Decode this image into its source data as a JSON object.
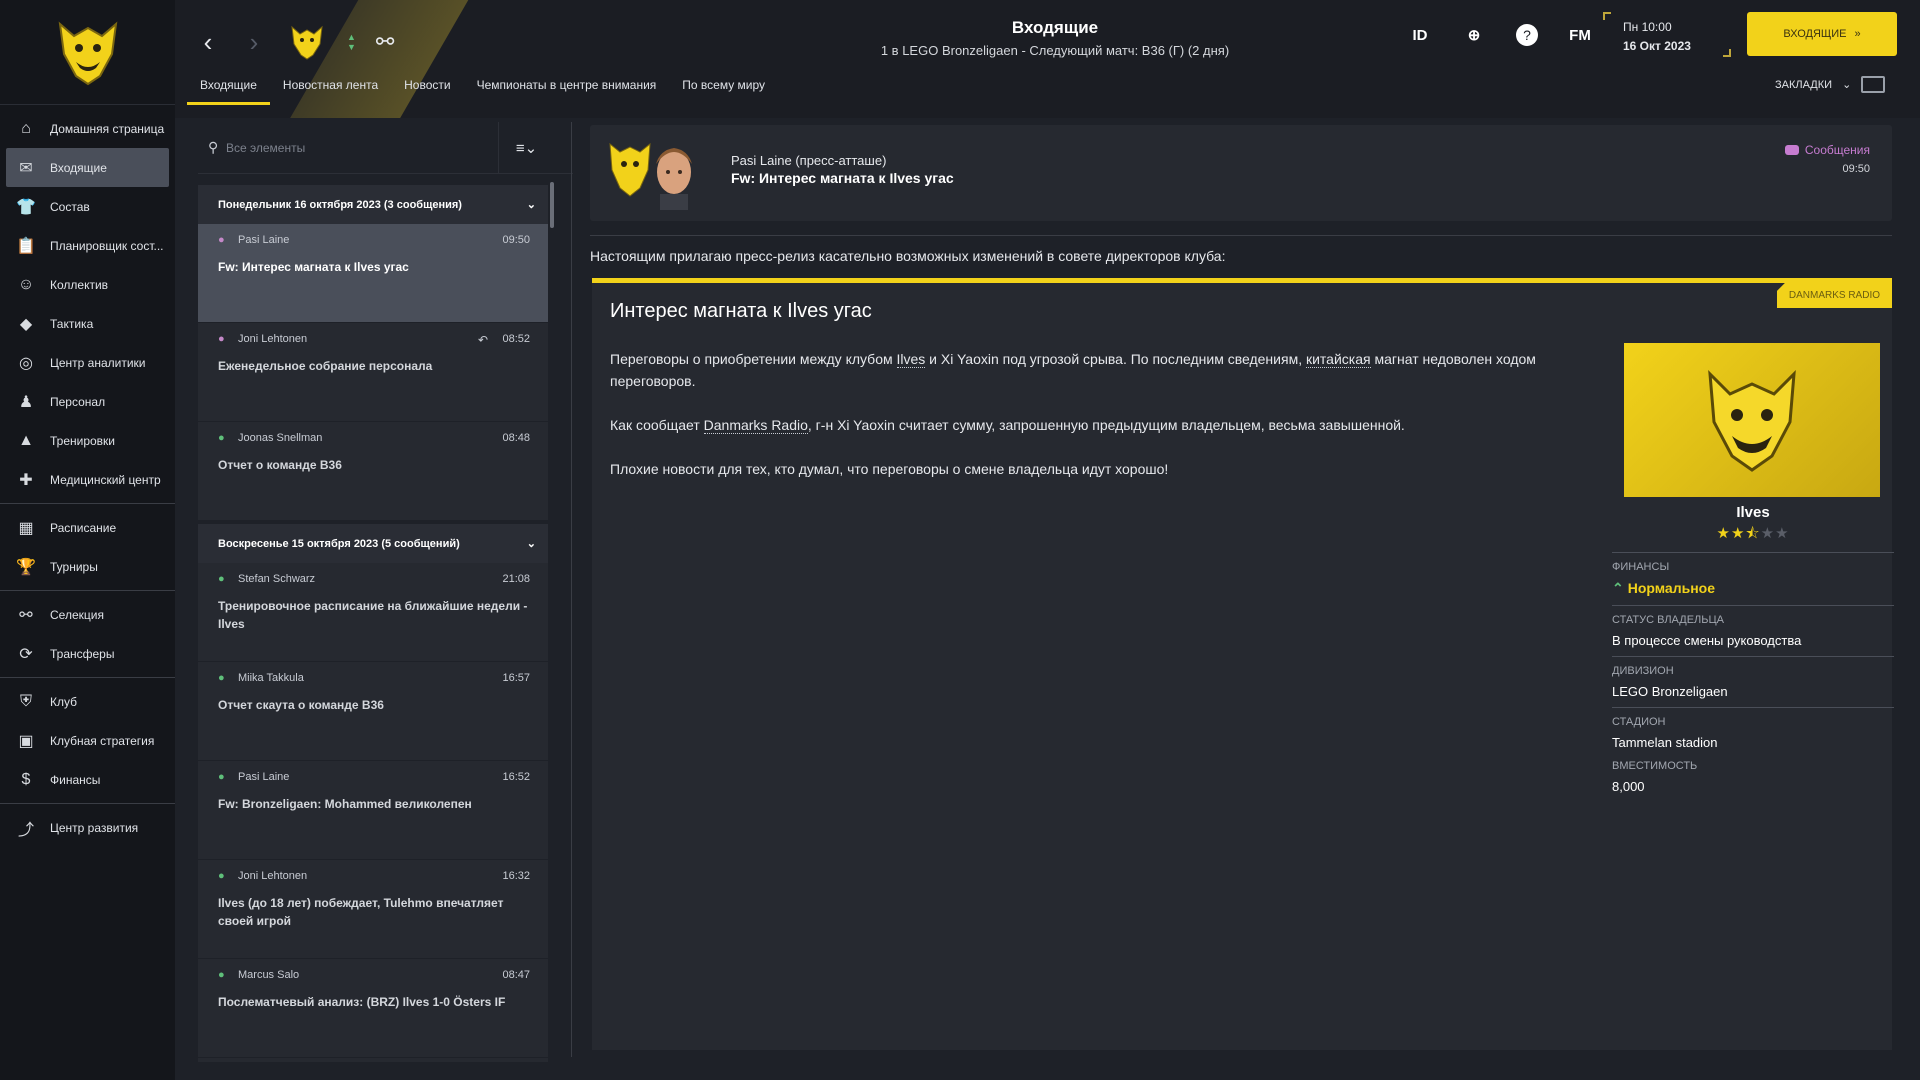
{
  "sidebar": {
    "items": [
      {
        "label": "Домашняя страница",
        "icon": "home-icon"
      },
      {
        "label": "Входящие",
        "icon": "mail-icon"
      },
      {
        "label": "Состав",
        "icon": "shirt-icon"
      },
      {
        "label": "Планировщик сост...",
        "icon": "clipboard-icon"
      },
      {
        "label": "Коллектив",
        "icon": "head-icon"
      },
      {
        "label": "Тактика",
        "icon": "tactics-icon"
      },
      {
        "label": "Центр аналитики",
        "icon": "analytics-icon"
      },
      {
        "label": "Персонал",
        "icon": "staff-icon"
      },
      {
        "label": "Тренировки",
        "icon": "cone-icon"
      },
      {
        "label": "Медицинский центр",
        "icon": "medical-icon"
      },
      {
        "label": "Расписание",
        "icon": "calendar-icon"
      },
      {
        "label": "Турниры",
        "icon": "trophy-icon"
      },
      {
        "label": "Селекция",
        "icon": "binoculars-icon"
      },
      {
        "label": "Трансферы",
        "icon": "transfer-icon"
      },
      {
        "label": "Клуб",
        "icon": "shield-icon"
      },
      {
        "label": "Клубная стратегия",
        "icon": "briefcase-icon"
      },
      {
        "label": "Финансы",
        "icon": "money-icon"
      },
      {
        "label": "Центр развития",
        "icon": "chart-icon"
      }
    ]
  },
  "header": {
    "title": "Входящие",
    "subtitle": "1 в LEGO Bronzeligaen - Следующий матч: B36 (Г) (2 дня)",
    "id_label": "ID",
    "fm_label": "FM",
    "time": "Пн 10:00",
    "date": "16 Окт 2023",
    "continue_label": "ВХОДЯЩИЕ",
    "bookmarks_label": "ЗАКЛАДКИ",
    "tabs": [
      "Входящие",
      "Новостная лента",
      "Новости",
      "Чемпионаты в центре внимания",
      "По всему миру"
    ]
  },
  "inbox": {
    "search_placeholder": "Все элементы",
    "groups": [
      {
        "title": "Понедельник 16 октября 2023 (3 сообщения)",
        "messages": [
          {
            "from": "Pasi Laine",
            "time": "09:50",
            "subject": "Fw: Интерес магната к Ilves угас"
          },
          {
            "from": "Joni Lehtonen",
            "time": "08:52",
            "subject": "Еженедельное собрание персонала"
          },
          {
            "from": "Joonas Snellman",
            "time": "08:48",
            "subject": "Отчет о команде B36"
          }
        ]
      },
      {
        "title": "Воскресенье 15 октября 2023 (5 сообщений)",
        "messages": [
          {
            "from": "Stefan Schwarz",
            "time": "21:08",
            "subject": "Тренировочное расписание на ближайшие недели - Ilves"
          },
          {
            "from": "Miika Takkula",
            "time": "16:57",
            "subject": "Отчет скаута о команде B36"
          },
          {
            "from": "Pasi Laine",
            "time": "16:52",
            "subject": "Fw: Bronzeligaen: Mohammed великолепен"
          },
          {
            "from": "Joni Lehtonen",
            "time": "16:32",
            "subject": "Ilves (до 18 лет) побеждает, Tulehmo впечатляет своей игрой"
          },
          {
            "from": "Marcus Salo",
            "time": "08:47",
            "subject": "Послематчевый анализ: (BRZ) Ilves 1-0 Östers IF"
          }
        ]
      }
    ]
  },
  "detail": {
    "sender": "Pasi Laine  (пресс-атташе)",
    "subject": "Fw: Интерес магната к Ilves угас",
    "tag": "Сообщения",
    "time": "09:50",
    "intro": "Настоящим прилагаю пресс-релиз касательно возможных изменений в совете директоров клуба:",
    "source": "DANMARKS RADIO",
    "article_title": "Интерес магната к Ilves угас",
    "p1_a": "Переговоры о приобретении между клубом ",
    "p1_link1": "Ilves",
    "p1_b": " и Xi Yaoxin под угрозой срыва. По последним сведениям, ",
    "p1_link2": "китайская",
    "p1_c": " магнат недоволен ходом переговоров.",
    "p2_a": "Как сообщает ",
    "p2_link": "Danmarks Radio",
    "p2_b": ", г-н Xi Yaoxin считает сумму, запрошенную предыдущим владельцем, весьма завышенной.",
    "p3": "Плохие новости для тех, кто думал, что переговоры о смене владельца идут хорошо!",
    "club": {
      "name": "Ilves",
      "stars": 2.5,
      "finance_label": "ФИНАНСЫ",
      "finance_value": "Нормальное",
      "owner_label": "СТАТУС ВЛАДЕЛЬЦА",
      "owner_value": "В процессе смены руководства",
      "division_label": "ДИВИЗИОН",
      "division_value": "LEGO Bronzeligaen",
      "stadium_label": "СТАДИОН",
      "stadium_value": "Tammelan stadion",
      "capacity_label": "ВМЕСТИМОСТЬ",
      "capacity_value": "8,000"
    }
  },
  "colors": {
    "accent": "#f2d21a",
    "message_tag": "#c67cd0",
    "positive": "#5fbf7a"
  }
}
